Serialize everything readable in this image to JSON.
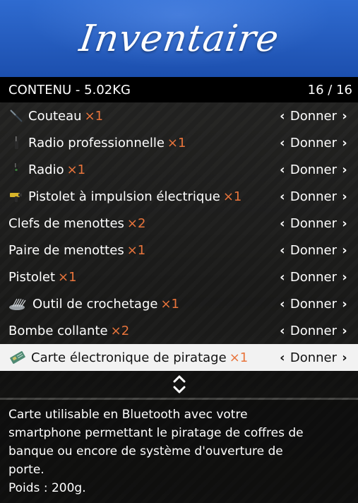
{
  "header": {
    "title": "Inventaire"
  },
  "subheader": {
    "contents": "CONTENU - 5.02KG",
    "page": "16 / 16"
  },
  "items": [
    {
      "name": "Couteau",
      "qty": "×1",
      "action": "Donner",
      "icon": "knife-icon"
    },
    {
      "name": "Radio professionnelle",
      "qty": "×1",
      "action": "Donner",
      "icon": "radio-pro-icon"
    },
    {
      "name": "Radio",
      "qty": "×1",
      "action": "Donner",
      "icon": "radio-icon"
    },
    {
      "name": "Pistolet à impulsion électrique",
      "qty": "×1",
      "action": "Donner",
      "icon": "taser-icon"
    },
    {
      "name": "Clefs de menottes",
      "qty": "×2",
      "action": "Donner",
      "icon": ""
    },
    {
      "name": "Paire de menottes",
      "qty": "×1",
      "action": "Donner",
      "icon": ""
    },
    {
      "name": "Pistolet",
      "qty": "×1",
      "action": "Donner",
      "icon": ""
    },
    {
      "name": "Outil de crochetage",
      "qty": "×1",
      "action": "Donner",
      "icon": "lockpick-icon"
    },
    {
      "name": "Bombe collante",
      "qty": "×2",
      "action": "Donner",
      "icon": ""
    },
    {
      "name": "Carte électronique de piratage",
      "qty": "×1",
      "action": "Donner",
      "icon": "hacking-card-icon",
      "selected": true
    }
  ],
  "description": {
    "lines": [
      "Carte utilisable en Bluetooth avec votre",
      "smartphone permettant le piratage de coffres de",
      "banque ou encore de système d'ouverture de",
      "porte.",
      "Poids : 200g."
    ]
  },
  "colors": {
    "banner": "#1c4fae",
    "qty": "#e8743b",
    "selected_row": "#f2f2f2"
  }
}
